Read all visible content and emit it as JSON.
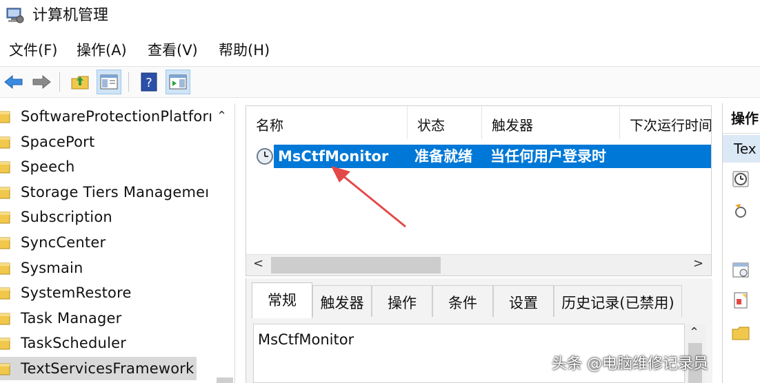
{
  "window": {
    "title": "计算机管理"
  },
  "menu": [
    {
      "label": "文件(F)"
    },
    {
      "label": "操作(A)"
    },
    {
      "label": "查看(V)"
    },
    {
      "label": "帮助(H)"
    }
  ],
  "toolbar": {
    "buttons": [
      "back-arrow-icon",
      "forward-arrow-icon",
      "folder-up-icon",
      "show-tree-icon",
      "help-icon",
      "show-action-pane-icon"
    ]
  },
  "tree": {
    "items": [
      {
        "label": "SoftwareProtectionPlatforı"
      },
      {
        "label": "SpacePort"
      },
      {
        "label": "Speech"
      },
      {
        "label": "Storage Tiers Managemeı"
      },
      {
        "label": "Subscription"
      },
      {
        "label": "SyncCenter"
      },
      {
        "label": "Sysmain"
      },
      {
        "label": "SystemRestore"
      },
      {
        "label": "Task Manager"
      },
      {
        "label": "TaskScheduler"
      },
      {
        "label": "TextServicesFramework",
        "selected": true
      }
    ]
  },
  "task_list": {
    "columns": [
      "名称",
      "状态",
      "触发器",
      "下次运行时间"
    ],
    "rows": [
      {
        "name": "MsCtfMonitor",
        "status": "准备就绪",
        "trigger": "当任何用户登录时",
        "selected": true
      }
    ]
  },
  "details": {
    "tabs": [
      {
        "label": "常规",
        "active": true
      },
      {
        "label": "触发器"
      },
      {
        "label": "操作"
      },
      {
        "label": "条件"
      },
      {
        "label": "设置"
      },
      {
        "label": "历史记录(已禁用)"
      }
    ],
    "name_value": "MsCtfMonitor"
  },
  "actions": {
    "header": "操作",
    "selected_item": "Tex"
  },
  "watermark": "头条 @电脑维修记录员",
  "colors": {
    "selection": "#0078d7",
    "annotation_arrow": "#e34848"
  }
}
